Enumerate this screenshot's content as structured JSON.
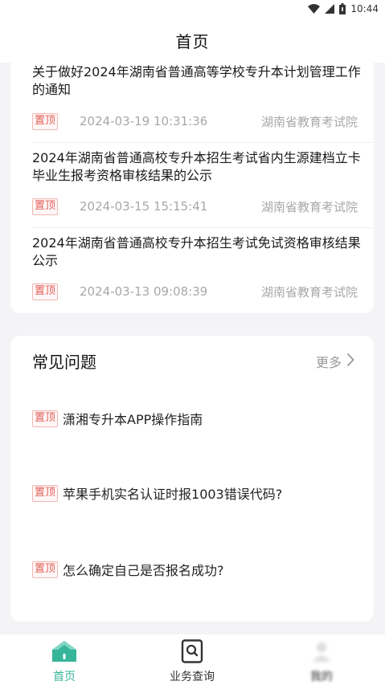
{
  "status_bar": {
    "time": "10:44"
  },
  "header": {
    "title": "首页"
  },
  "news": {
    "tag_label": "置顶",
    "items": [
      {
        "title": "关于做好2024年湖南省普通高等学校专升本计划管理工作的通知",
        "date": "2024-03-19 10:31:36",
        "source": "湖南省教育考试院"
      },
      {
        "title": "2024年湖南省普通高校专升本招生考试省内生源建档立卡毕业生报考资格审核结果的公示",
        "date": "2024-03-15 15:15:41",
        "source": "湖南省教育考试院"
      },
      {
        "title": "2024年湖南省普通高校专升本招生考试免试资格审核结果公示",
        "date": "2024-03-13 09:08:39",
        "source": "湖南省教育考试院"
      }
    ]
  },
  "faq": {
    "title": "常见问题",
    "more_label": "更多",
    "tag_label": "置顶",
    "items": [
      {
        "text": "潇湘专升本APP操作指南"
      },
      {
        "text": "苹果手机实名认证时报1003错误代码?"
      },
      {
        "text": "怎么确定自己是否报名成功?"
      }
    ]
  },
  "tab_bar": {
    "tabs": [
      {
        "label": "首页",
        "icon": "home-icon",
        "active": true
      },
      {
        "label": "业务查询",
        "icon": "search-document-icon",
        "active": false
      },
      {
        "label": "我的",
        "icon": "user-icon",
        "active": false
      }
    ],
    "accent_color": "#36b59a"
  },
  "colors": {
    "tag_border": "#f0b7b3",
    "tag_text": "#e0605a",
    "muted_text": "#a8a8a8"
  }
}
